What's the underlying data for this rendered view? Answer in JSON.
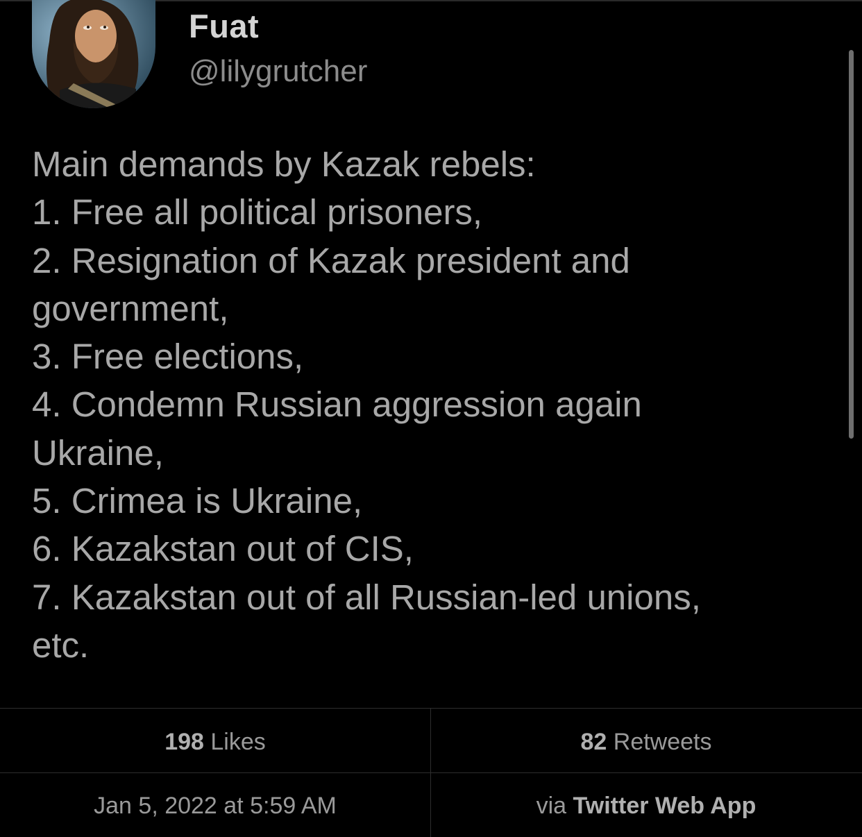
{
  "user": {
    "display_name": "Fuat",
    "handle": "@lilygrutcher"
  },
  "tweet": {
    "lines": [
      "Main demands by Kazak rebels:",
      "1. Free all political prisoners,",
      "2. Resignation of Kazak president and",
      "government,",
      "3. Free elections,",
      "4. Condemn Russian aggression again",
      "Ukraine,",
      "5. Crimea is Ukraine,",
      "6. Kazakstan out of CIS,",
      "7. Kazakstan out of all Russian-led unions,",
      "etc."
    ]
  },
  "stats": {
    "likes_count": "198",
    "likes_label": " Likes",
    "retweets_count": "82",
    "retweets_label": " Retweets",
    "timestamp": "Jan 5, 2022 at 5:59 AM",
    "via_prefix": "via ",
    "via_app": "Twitter Web App"
  },
  "colors": {
    "background": "#000000",
    "text": "#a8a8a8",
    "divider": "#2e2e2e"
  }
}
